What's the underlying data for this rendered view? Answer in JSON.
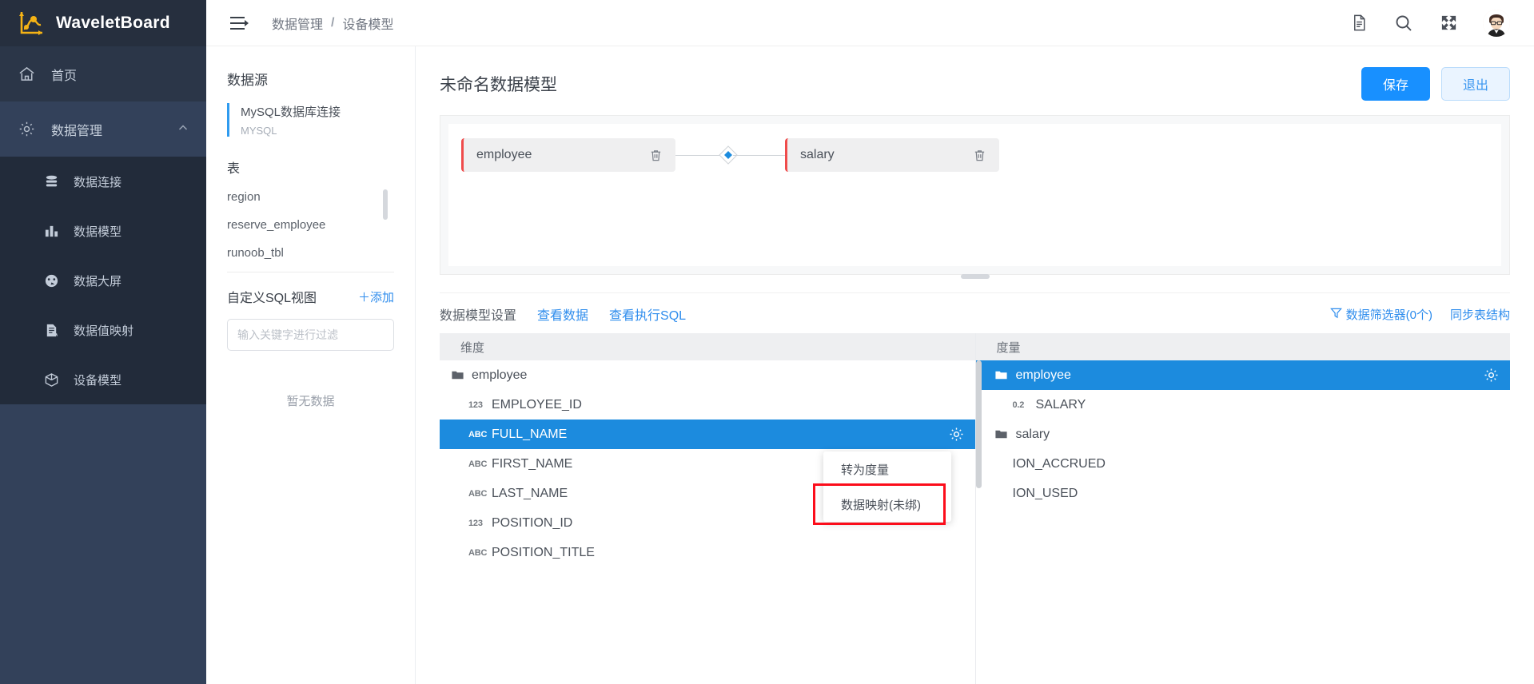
{
  "brand": {
    "name": "WaveletBoard",
    "logo_icon": "wavelet-logo-icon"
  },
  "sidebar": {
    "home": {
      "label": "首页",
      "icon": "home-icon"
    },
    "group": {
      "label": "数据管理",
      "icon": "gear-icon",
      "caret": "chevron-up-icon"
    },
    "submenu": [
      {
        "label": "数据连接",
        "icon": "database-icon"
      },
      {
        "label": "数据模型",
        "icon": "bar-chart-icon"
      },
      {
        "label": "数据大屏",
        "icon": "dashboard-icon"
      },
      {
        "label": "数据值映射",
        "icon": "document-edit-icon"
      },
      {
        "label": "设备模型",
        "icon": "cube-icon"
      }
    ]
  },
  "topbar": {
    "menu_toggle_icon": "hamburger-collapse-icon",
    "breadcrumb": [
      "数据管理",
      "设备模型"
    ],
    "separator": "/",
    "icons": [
      "document-icon",
      "search-icon",
      "fullscreen-icon"
    ],
    "avatar": "user-avatar"
  },
  "datasource": {
    "title": "数据源",
    "connection": {
      "name": "MySQL数据库连接",
      "type": "MYSQL"
    },
    "tables_title": "表",
    "tables": [
      "region",
      "reserve_employee",
      "runoob_tbl"
    ],
    "sqlview_title": "自定义SQL视图",
    "sqlview_add": "＋添加",
    "filter_placeholder": "输入关键字进行过滤",
    "filter_value": "",
    "empty_text": "暂无数据"
  },
  "workspace": {
    "title": "未命名数据模型",
    "save_label": "保存",
    "exit_label": "退出",
    "nodes": [
      {
        "label": "employee",
        "delete_icon": "trash-icon"
      },
      {
        "label": "salary",
        "delete_icon": "trash-icon"
      }
    ],
    "join_icon": "join-diamond-icon"
  },
  "tabs": [
    {
      "label": "数据模型设置",
      "active": true
    },
    {
      "label": "查看数据",
      "active": false
    },
    {
      "label": "查看执行SQL",
      "active": false
    }
  ],
  "tab_actions": [
    {
      "label": "数据筛选器(0个)",
      "icon": "filter-icon"
    },
    {
      "label": "同步表结构",
      "icon": ""
    }
  ],
  "dimensions": {
    "header": "维度",
    "rows": [
      {
        "name": "employee",
        "kind": "folder",
        "type": "",
        "selected": false
      },
      {
        "name": "EMPLOYEE_ID",
        "kind": "field",
        "type": "123",
        "selected": false
      },
      {
        "name": "FULL_NAME",
        "kind": "field",
        "type": "ABC",
        "selected": true,
        "gear_icon": "gear-icon"
      },
      {
        "name": "FIRST_NAME",
        "kind": "field",
        "type": "ABC",
        "selected": false
      },
      {
        "name": "LAST_NAME",
        "kind": "field",
        "type": "ABC",
        "selected": false
      },
      {
        "name": "POSITION_ID",
        "kind": "field",
        "type": "123",
        "selected": false
      },
      {
        "name": "POSITION_TITLE",
        "kind": "field",
        "type": "ABC",
        "selected": false
      }
    ]
  },
  "measures": {
    "header": "度量",
    "rows": [
      {
        "name": "employee",
        "kind": "folder",
        "type": "",
        "selected": true,
        "gear_icon": "gear-icon"
      },
      {
        "name": "SALARY",
        "kind": "field",
        "type": "0.2",
        "selected": false
      },
      {
        "name": "salary",
        "kind": "folder",
        "type": "",
        "selected": false
      },
      {
        "name": "ION_ACCRUED",
        "kind": "field",
        "type": "",
        "selected": false
      },
      {
        "name": "ION_USED",
        "kind": "field",
        "type": "",
        "selected": false
      }
    ]
  },
  "context_menu": {
    "items": [
      "转为度量",
      "数据映射(未绑)"
    ],
    "highlight_index": 1,
    "highlight_color": "#fc0d1b"
  },
  "colors": {
    "accent": "#1890ff",
    "sidebar": "#2b3648",
    "sidebar_dark": "#222b3a",
    "sidebar_group": "#33415a",
    "selection": "#1c8bde",
    "node_bar": "#ef4b4b",
    "link": "#2f8ded"
  }
}
